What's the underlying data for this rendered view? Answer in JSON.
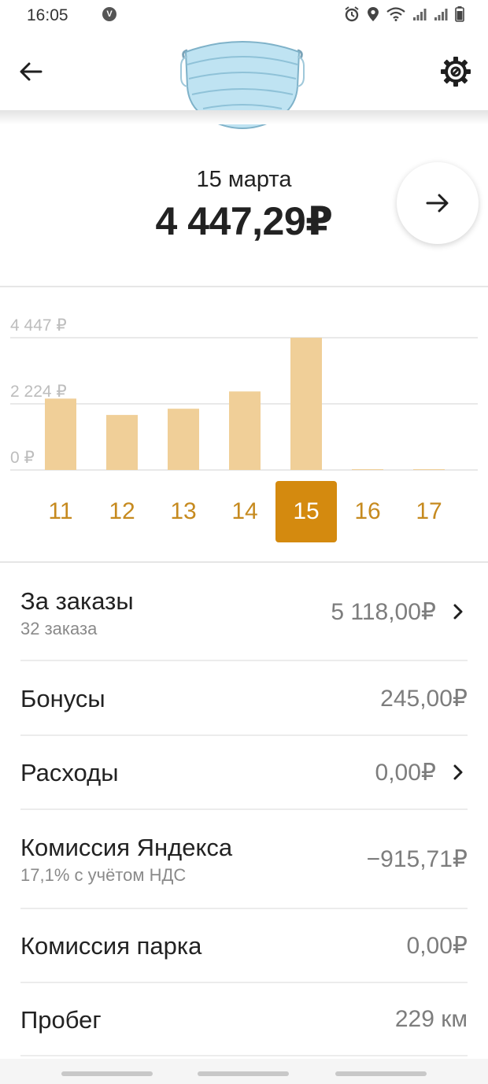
{
  "status_bar": {
    "time": "16:05",
    "v_badge": "V",
    "icons": [
      "alarm-icon",
      "location-icon",
      "wifi-icon",
      "signal-icon",
      "signal-icon",
      "battery-icon"
    ]
  },
  "header": {
    "back_icon": "arrow-left-icon",
    "settings_icon": "gear-icon",
    "decoration": "medical-mask-illustration"
  },
  "summary": {
    "date": "15 марта",
    "total": "4 447,29₽",
    "next_icon": "arrow-right-icon"
  },
  "chart_data": {
    "type": "bar",
    "categories": [
      "11",
      "12",
      "13",
      "14",
      "15",
      "16",
      "17"
    ],
    "values": [
      2400,
      1850,
      2060,
      2640,
      4447,
      0,
      0
    ],
    "selected": "15",
    "yticks": [
      "4 447 ₽",
      "2 224 ₽",
      "0 ₽"
    ],
    "ytick_values": [
      4447,
      2224,
      0
    ],
    "ylim": [
      0,
      4447
    ],
    "bar_color": "#f0cf98",
    "selected_color": "#d48a0f",
    "grid": true
  },
  "rows": [
    {
      "title": "За заказы",
      "subtitle": "32 заказа",
      "value": "5 118,00₽",
      "chevron": true
    },
    {
      "title": "Бонусы",
      "subtitle": "",
      "value": "245,00₽",
      "chevron": false
    },
    {
      "title": "Расходы",
      "subtitle": "",
      "value": "0,00₽",
      "chevron": true
    },
    {
      "title": "Комиссия Яндекса",
      "subtitle": "17,1% с учётом НДС",
      "value": "−915,71₽",
      "chevron": false
    },
    {
      "title": "Комиссия парка",
      "subtitle": "",
      "value": "0,00₽",
      "chevron": false
    },
    {
      "title": "Пробег",
      "subtitle": "",
      "value": "229 км",
      "chevron": false
    }
  ]
}
